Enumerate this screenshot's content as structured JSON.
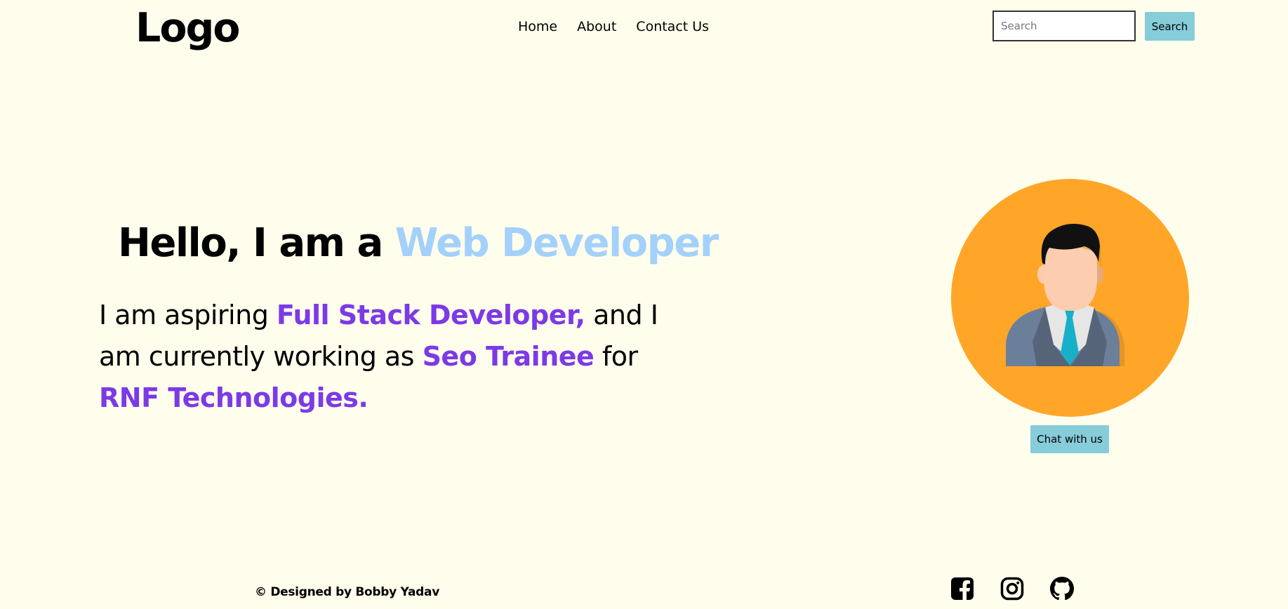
{
  "header": {
    "logo": "Logo",
    "nav": [
      {
        "label": "Home"
      },
      {
        "label": "About"
      },
      {
        "label": "Contact Us"
      }
    ],
    "search": {
      "placeholder": "Search",
      "button_label": "Search"
    }
  },
  "hero": {
    "title_prefix": "Hello, I am a ",
    "title_accent": "Web Developer",
    "intro_part1": "I am aspiring ",
    "intro_highlight1": "Full Stack Developer,",
    "intro_part2": " and I am currently working as ",
    "intro_highlight2": "Seo Trainee",
    "intro_part3": " for ",
    "intro_highlight3": "RNF Technologies."
  },
  "profile": {
    "chat_button": "Chat with us"
  },
  "footer": {
    "credit": "© Designed by Bobby Yadav",
    "social_icons": [
      "facebook-icon",
      "instagram-icon",
      "github-icon"
    ]
  },
  "colors": {
    "background": "#fffeec",
    "accent_blue": "#a3d1fb",
    "highlight_purple": "#7c3ae6",
    "button_teal": "#86ccd9",
    "avatar_orange": "#ffa629"
  }
}
